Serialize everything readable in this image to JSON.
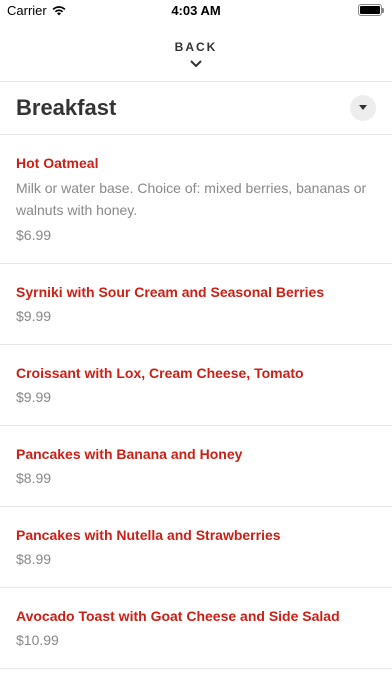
{
  "status_bar": {
    "carrier": "Carrier",
    "time": "4:03 AM"
  },
  "nav": {
    "back_label": "BACK"
  },
  "section": {
    "title": "Breakfast"
  },
  "items": [
    {
      "name": "Hot Oatmeal",
      "description": "Milk or water base. Choice of: mixed berries, bananas or walnuts with honey.",
      "price": "$6.99"
    },
    {
      "name": "Syrniki with Sour Cream and Seasonal Berries",
      "description": "",
      "price": "$9.99"
    },
    {
      "name": "Croissant with Lox, Cream Cheese, Tomato",
      "description": "",
      "price": "$9.99"
    },
    {
      "name": "Pancakes with Banana and Honey",
      "description": "",
      "price": "$8.99"
    },
    {
      "name": "Pancakes with Nutella and Strawberries",
      "description": "",
      "price": "$8.99"
    },
    {
      "name": "Avocado Toast with Goat Cheese and Side Salad",
      "description": "",
      "price": "$10.99"
    }
  ],
  "colors": {
    "item_name": "#cc1f16",
    "muted_text": "#888888",
    "divider": "#e6e6e6"
  }
}
